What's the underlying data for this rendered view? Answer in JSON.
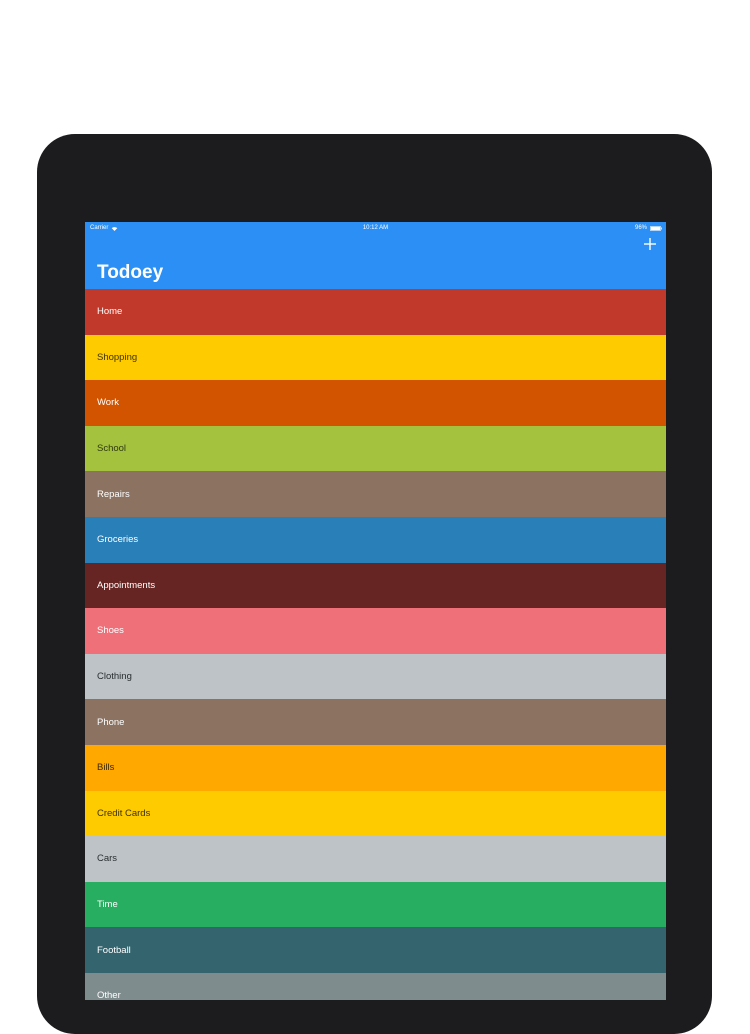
{
  "status_bar": {
    "carrier": "Carrier",
    "time": "10:12 AM",
    "battery": "96%"
  },
  "navbar": {
    "title": "Todoey",
    "add_icon": "plus-icon"
  },
  "categories": [
    {
      "name": "Home",
      "color": "#c0392b",
      "text_color": "#ffffff"
    },
    {
      "name": "Shopping",
      "color": "#fecb00",
      "text_color": "#3d3300"
    },
    {
      "name": "Work",
      "color": "#d35400",
      "text_color": "#ffffff"
    },
    {
      "name": "School",
      "color": "#a5c23e",
      "text_color": "#2e3a10"
    },
    {
      "name": "Repairs",
      "color": "#8b7261",
      "text_color": "#ffffff"
    },
    {
      "name": "Groceries",
      "color": "#2980b9",
      "text_color": "#ffffff"
    },
    {
      "name": "Appointments",
      "color": "#662522",
      "text_color": "#ffffff"
    },
    {
      "name": "Shoes",
      "color": "#f0707a",
      "text_color": "#ffffff"
    },
    {
      "name": "Clothing",
      "color": "#bdc3c7",
      "text_color": "#2a2e31"
    },
    {
      "name": "Phone",
      "color": "#8b7261",
      "text_color": "#ffffff"
    },
    {
      "name": "Bills",
      "color": "#ffa800",
      "text_color": "#3d2800"
    },
    {
      "name": "Credit Cards",
      "color": "#fecb00",
      "text_color": "#3d3300"
    },
    {
      "name": "Cars",
      "color": "#bdc3c7",
      "text_color": "#2a2e31"
    },
    {
      "name": "Time",
      "color": "#27ae60",
      "text_color": "#ffffff"
    },
    {
      "name": "Football",
      "color": "#34656f",
      "text_color": "#ffffff"
    },
    {
      "name": "Other",
      "color": "#7f8c8d",
      "text_color": "#ffffff"
    }
  ]
}
